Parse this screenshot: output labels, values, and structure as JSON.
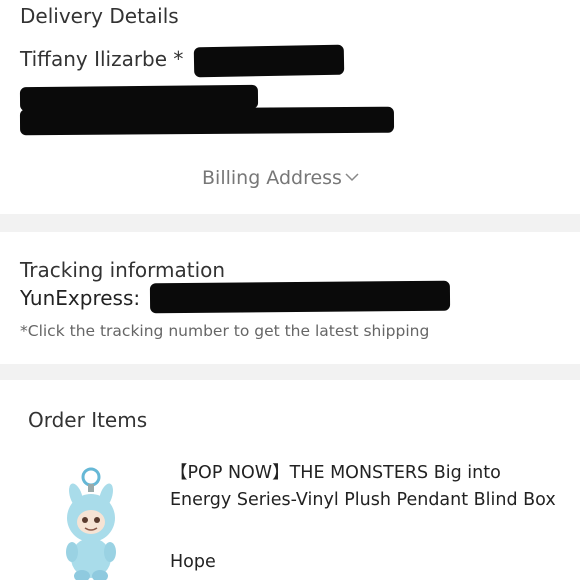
{
  "delivery": {
    "title": "Delivery Details",
    "recipient_name": "Tiffany Ilizarbe *",
    "billing_label": "Billing Address",
    "billing_icon": "chevron-down-icon"
  },
  "tracking": {
    "title": "Tracking information",
    "carrier": "YunExpress:",
    "hint": "*Click the tracking number to get the latest shipping"
  },
  "order": {
    "title": "Order Items",
    "product_title": "【POP NOW】THE MONSTERS Big into Energy Series-Vinyl Plush Pendant Blind Box",
    "variant": "Hope"
  },
  "colors": {
    "divider": "#f2f2f2",
    "redaction": "#0a0a0a",
    "plush": "#a9dcea"
  }
}
